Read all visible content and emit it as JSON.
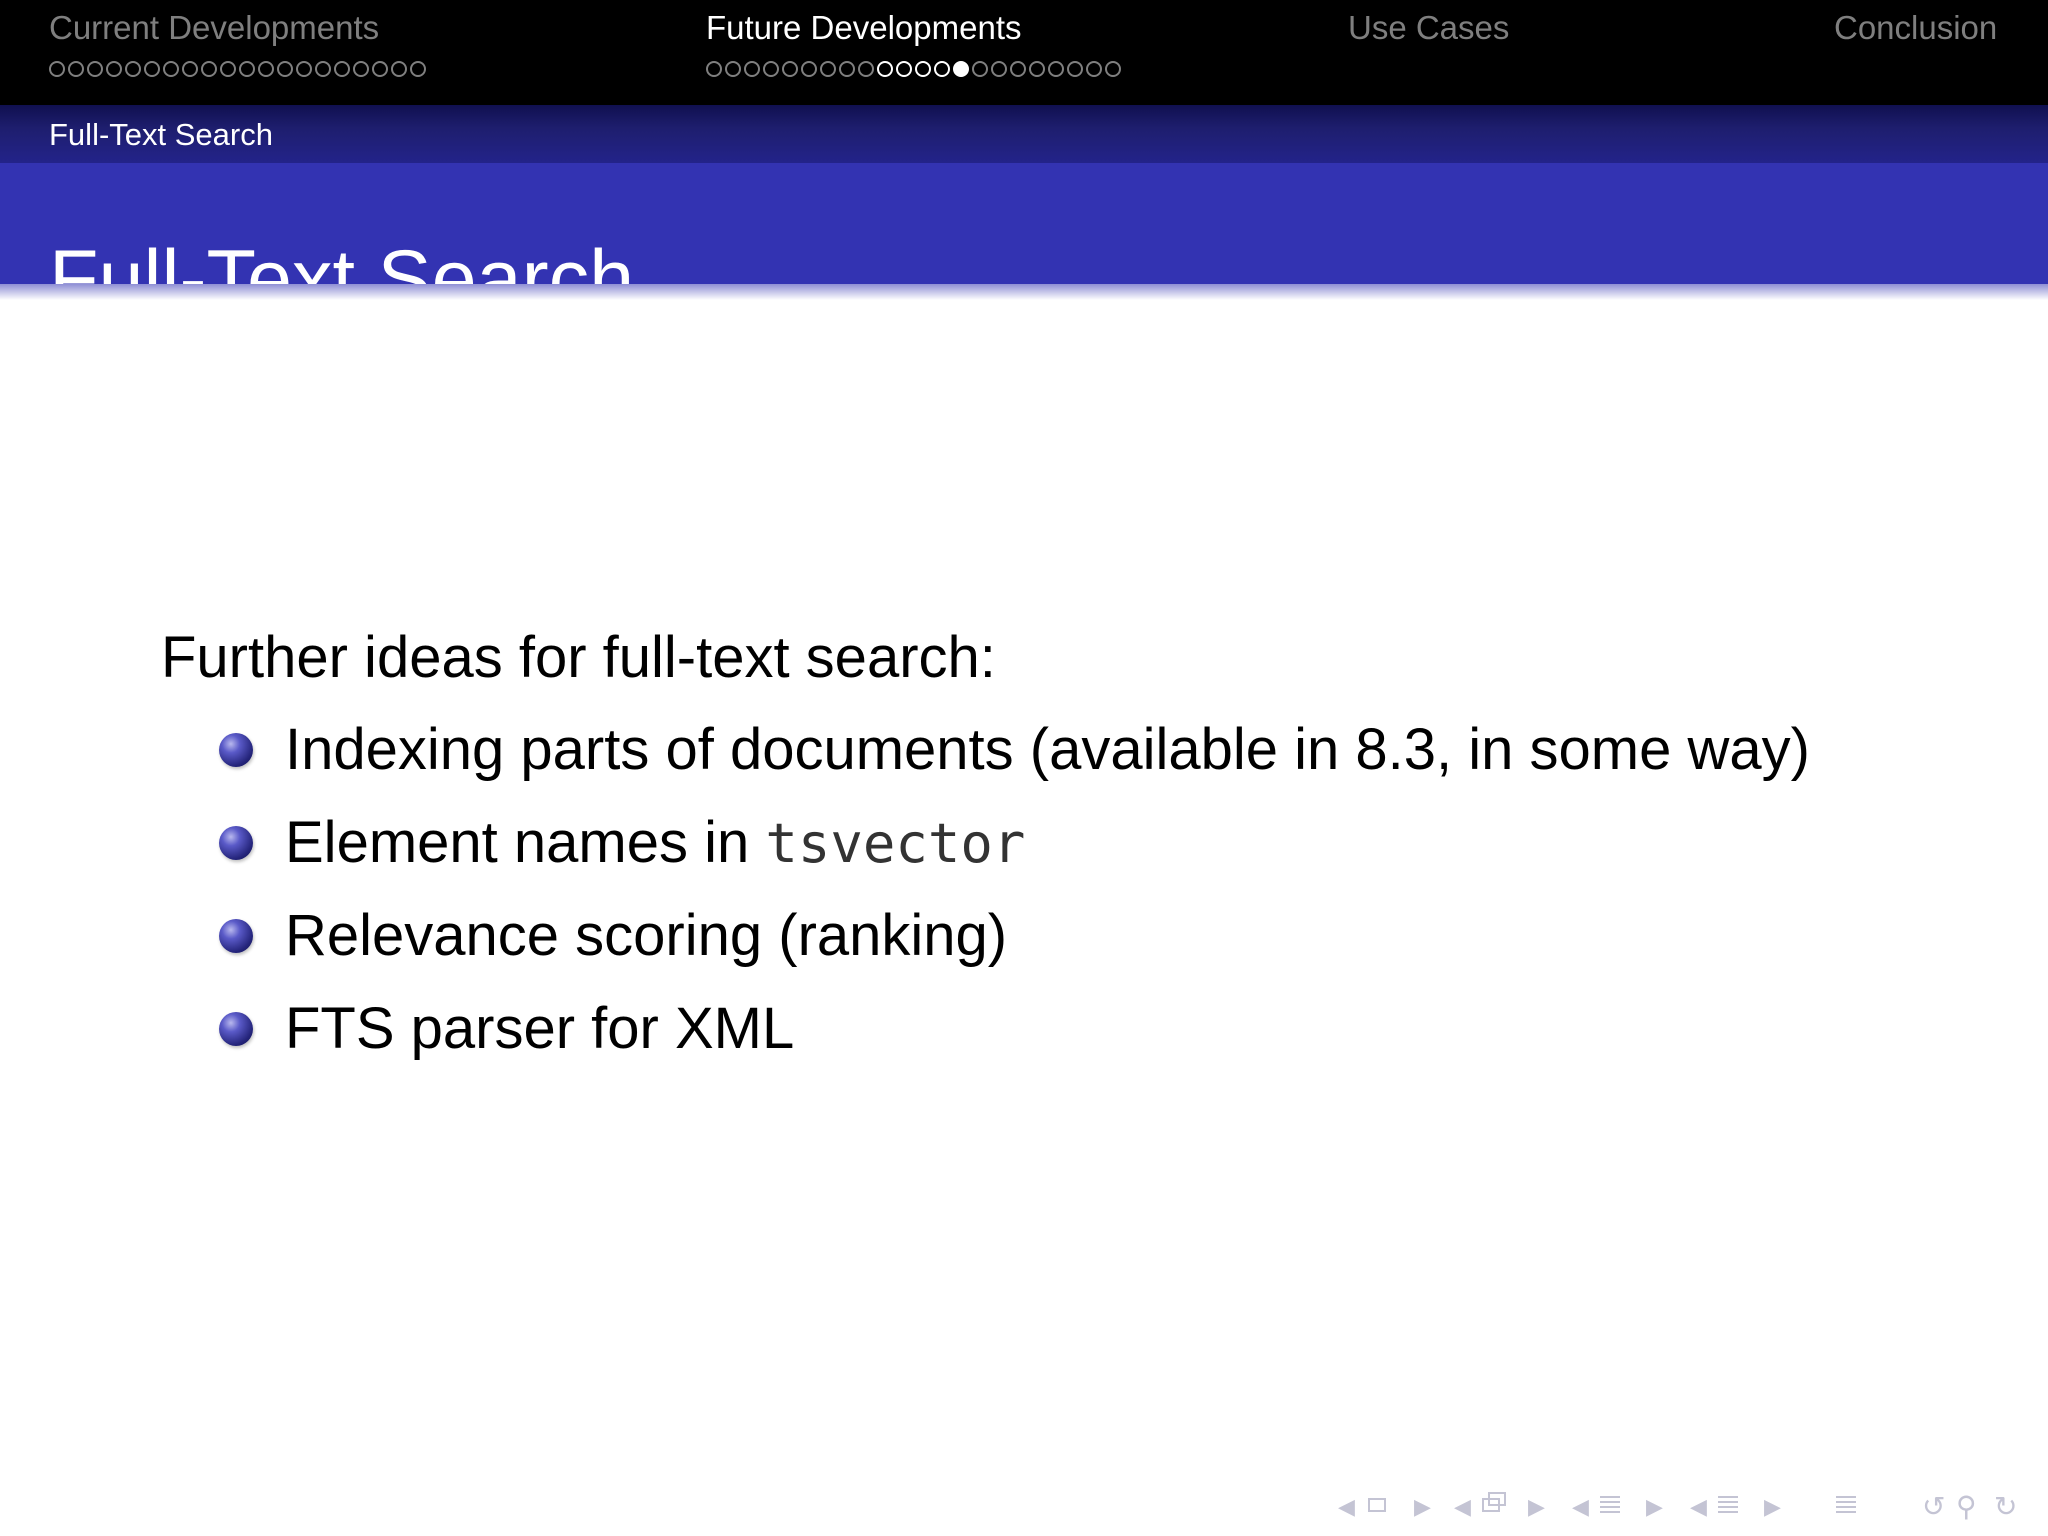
{
  "navigation": {
    "sections": [
      {
        "label": "Current Developments",
        "active": false,
        "dots": 20,
        "current_dot": null
      },
      {
        "label": "Future Developments",
        "active": true,
        "dots": 22,
        "bright_range": [
          9,
          13
        ],
        "current_dot": 13
      },
      {
        "label": "Use Cases",
        "active": false,
        "dots": 0,
        "current_dot": null
      },
      {
        "label": "Conclusion",
        "active": false,
        "dots": 0,
        "current_dot": null
      }
    ]
  },
  "subsection": {
    "label": "Full-Text Search"
  },
  "frame": {
    "title": "Full-Text Search"
  },
  "body": {
    "intro": "Further ideas for full-text search:",
    "items": [
      {
        "text": "Indexing parts of documents (available in 8.3, in some way)"
      },
      {
        "text": "Element names in ",
        "code": "tsvector"
      },
      {
        "text": "Relevance scoring (ranking)"
      },
      {
        "text": "FTS parser for XML"
      }
    ]
  },
  "nav_symbols": {
    "icons": [
      "prev-slide-icon",
      "slide-icon",
      "next-slide-icon",
      "prev-frame-icon",
      "frame-icon",
      "next-frame-icon",
      "prev-subsection-icon",
      "subsection-icon",
      "next-subsection-icon",
      "prev-section-icon",
      "section-icon",
      "next-section-icon",
      "document-icon",
      "back-icon",
      "search-icon",
      "forward-icon"
    ]
  },
  "colors": {
    "topnav_bg": "#000000",
    "subbar_bg": "#1e1e6e",
    "titlebar_bg": "#3333b2",
    "inactive_text": "#7f7f7f",
    "active_text": "#ffffff",
    "bullet": "#2a2a88"
  }
}
